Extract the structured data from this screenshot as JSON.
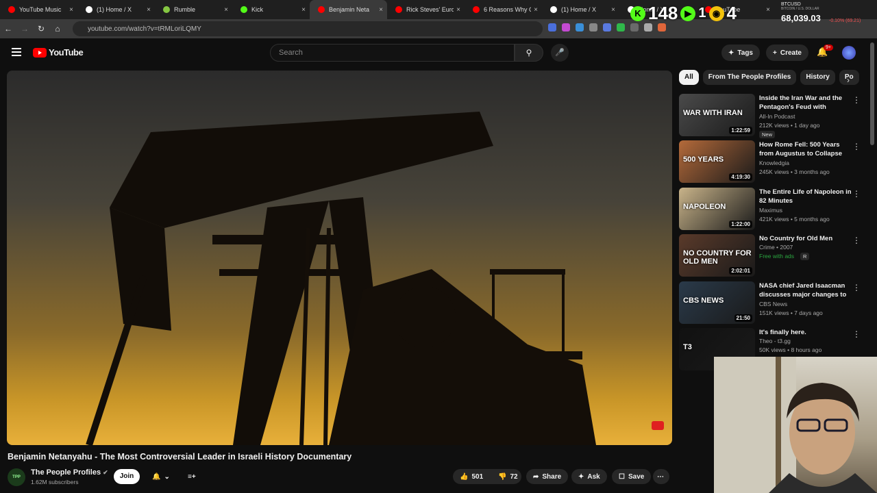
{
  "browser": {
    "tabs": [
      {
        "label": "YouTube Music",
        "color": "#ff0000"
      },
      {
        "label": "(1) Home / X",
        "color": "#ffffff"
      },
      {
        "label": "Rumble",
        "color": "#85c742"
      },
      {
        "label": "Kick",
        "color": "#53fc18"
      },
      {
        "label": "Benjamin Neta",
        "color": "#ff0000"
      },
      {
        "label": "Rick Steves' Europ",
        "color": "#ff0000"
      },
      {
        "label": "6 Reasons Why C",
        "color": "#ff0000"
      },
      {
        "label": "(1) Home / X",
        "color": "#ffffff"
      },
      {
        "label": "Home / X",
        "color": "#ffffff"
      },
      {
        "label": "YouTube",
        "color": "#ff0000"
      }
    ],
    "tab_close": "×",
    "url": "youtube.com/watch?v=tRMLoriLQMY"
  },
  "stream_overlay": {
    "kick_count": "148",
    "viewer_count": "4",
    "ticker_symbol": "BTCUSD",
    "ticker_name": "BITCOIN / U.S. DOLLAR",
    "ticker_price": "68,039.03",
    "ticker_change": "-0.10% (69.21)"
  },
  "youtube": {
    "logo_text": "YouTube",
    "search_placeholder": "Search",
    "tags_label": "Tags",
    "create_label": "Create",
    "notif_badge": "9+"
  },
  "video": {
    "title": "Benjamin Netanyahu - The Most Controversial Leader in Israeli History Documentary",
    "channel_name": "The People Profiles",
    "subscribers": "1.62M subscribers",
    "join_label": "Join",
    "likes": "501",
    "dislikes": "72",
    "share_label": "Share",
    "ask_label": "Ask",
    "save_label": "Save"
  },
  "sidebar": {
    "chips": [
      "All",
      "From The People Profiles",
      "History",
      "Po"
    ],
    "recommendations": [
      {
        "title": "Inside the Iran War and the Pentagon's Feud with Anthropi...",
        "channel": "All-In Podcast",
        "meta": "212K views • 1 day ago",
        "badge": "New",
        "duration": "1:22:59",
        "thumb_text": "WAR WITH IRAN",
        "thumb_color": "#4a4a4a"
      },
      {
        "title": "How Rome Fell: 500 Years from Augustus to Collapse",
        "channel": "Knowledgia",
        "meta": "245K views • 3 months ago",
        "badge": "",
        "duration": "4:19:30",
        "thumb_text": "500 YEARS",
        "thumb_color": "#b46a3a"
      },
      {
        "title": "The Entire Life of Napoleon in 82 Minutes",
        "channel": "Maximus",
        "meta": "421K views • 5 months ago",
        "badge": "",
        "duration": "1:22:00",
        "thumb_text": "NAPOLEON",
        "thumb_color": "#c9b48a"
      },
      {
        "title": "No Country for Old Men",
        "channel": "Crime • 2007",
        "meta": "Free with ads",
        "badge": "R",
        "duration": "2:02:01",
        "thumb_text": "NO COUNTRY FOR OLD MEN",
        "thumb_color": "#5a3a2a"
      },
      {
        "title": "NASA chief Jared Isaacman discusses major changes to ...",
        "channel": "CBS News",
        "meta": "151K views • 7 days ago",
        "badge": "",
        "duration": "21:50",
        "thumb_text": "CBS NEWS",
        "thumb_color": "#2a3a4a"
      },
      {
        "title": "It's finally here.",
        "channel": "Theo - t3.gg",
        "meta": "50K views • 8 hours ago",
        "badge": "",
        "duration": "",
        "thumb_text": "T3",
        "thumb_color": "#111111"
      }
    ]
  }
}
